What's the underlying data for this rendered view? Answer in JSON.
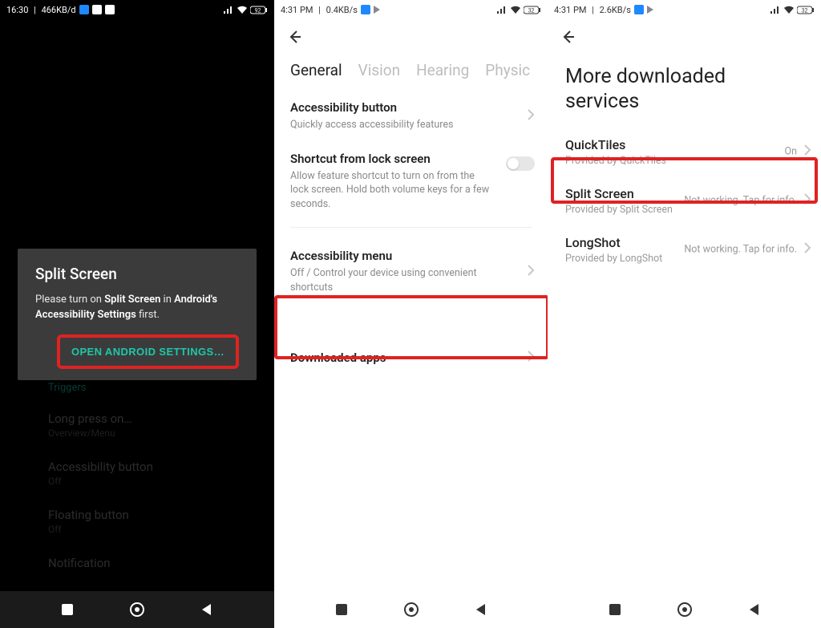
{
  "screen1": {
    "status": {
      "time": "16:30",
      "net": "466KB/d"
    },
    "dialog": {
      "title": "Split Screen",
      "msg_pre": "Please turn on ",
      "msg_b1": "Split Screen",
      "msg_mid": " in ",
      "msg_b2": "Android's Accessibility Settings",
      "msg_post": " first.",
      "button": "OPEN ANDROID SETTINGS…"
    },
    "list": {
      "section": "Triggers",
      "items": [
        {
          "title": "Long press on…",
          "sub": "Overview/Menu"
        },
        {
          "title": "Accessibility button",
          "sub": "Off"
        },
        {
          "title": "Floating button",
          "sub": "Off"
        },
        {
          "title": "Notification",
          "sub": ""
        }
      ]
    }
  },
  "screen2": {
    "status": {
      "time": "4:31 PM",
      "net": "0.4KB/s"
    },
    "tabs": [
      "General",
      "Vision",
      "Hearing",
      "Physic"
    ],
    "items": [
      {
        "title": "Accessibility button",
        "sub": "Quickly access accessibility features",
        "type": "chevron"
      },
      {
        "title": "Shortcut from lock screen",
        "sub": "Allow feature shortcut to turn on from the lock screen. Hold both volume keys for a few seconds.",
        "type": "toggle"
      },
      {
        "title": "Accessibility menu",
        "sub": "Off / Control your device using convenient shortcuts",
        "type": "chevron"
      },
      {
        "title": "Downloaded apps",
        "sub": "",
        "type": "chevron"
      }
    ]
  },
  "screen3": {
    "status": {
      "time": "4:31 PM",
      "net": "2.6KB/s"
    },
    "title": "More downloaded services",
    "services": [
      {
        "title": "QuickTiles",
        "sub": "Provided by QuickTiles",
        "status": "On"
      },
      {
        "title": "Split Screen",
        "sub": "Provided by Split Screen",
        "status": "Not working. Tap for info."
      },
      {
        "title": "LongShot",
        "sub": "Provided by LongShot",
        "status": "Not working. Tap for info."
      }
    ]
  }
}
